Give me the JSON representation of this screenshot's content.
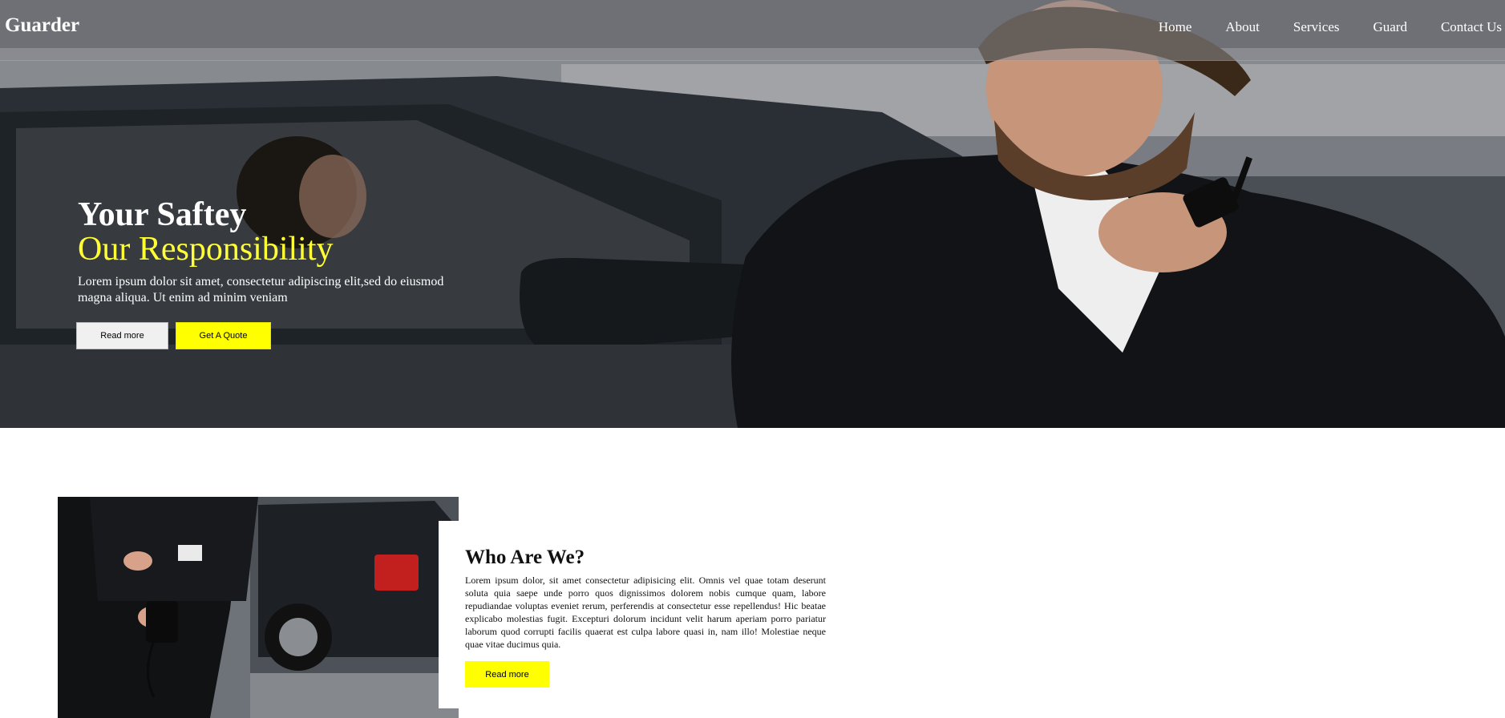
{
  "brand": "Guarder",
  "nav": {
    "items": [
      "Home",
      "About",
      "Services",
      "Guard",
      "Contact Us"
    ]
  },
  "hero": {
    "title": "Your Saftey",
    "subtitle": "Our Responsibility",
    "description": "Lorem ipsum dolor sit amet, consectetur adipiscing elit,sed do eiusmod magna aliqua. Ut enim ad minim veniam",
    "read_more": "Read more",
    "quote": "Get A Quote"
  },
  "who": {
    "title": "Who Are We?",
    "text": "Lorem ipsum dolor, sit amet consectetur adipisicing elit. Omnis vel quae totam deserunt soluta quia saepe unde porro quos dignissimos dolorem nobis cumque quam, labore repudiandae voluptas eveniet rerum, perferendis at consectetur esse repellendus! Hic beatae explicabo molestias fugit. Excepturi dolorum incidunt velit harum aperiam porro pariatur laborum quod corrupti facilis quaerat est culpa labore quasi in, nam illo! Molestiae neque quae vitae ducimus quia.",
    "read_more": "Read more"
  },
  "colors": {
    "accent": "#ffff00",
    "subtitle": "#ffff33",
    "nav_text": "#ffffff"
  }
}
